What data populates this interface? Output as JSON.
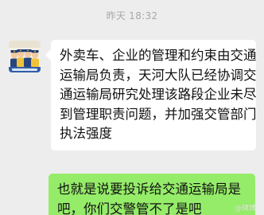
{
  "chat": {
    "timestamp": "昨天 18:32",
    "messages": [
      {
        "sender": "other",
        "lines": [
          "外卖车、企业的管理和约束由交通",
          "运输局负责，天河大队已经协调交",
          "通运输局研究处理该路段企业未尽",
          "到管理职责问题，并加强交管部门",
          "执法强度"
        ]
      },
      {
        "sender": "self",
        "lines": [
          "也就是说要投诉给交通运输局是",
          "吧，你们交警管不了是吧"
        ]
      }
    ]
  },
  "watermark": "@微博"
}
